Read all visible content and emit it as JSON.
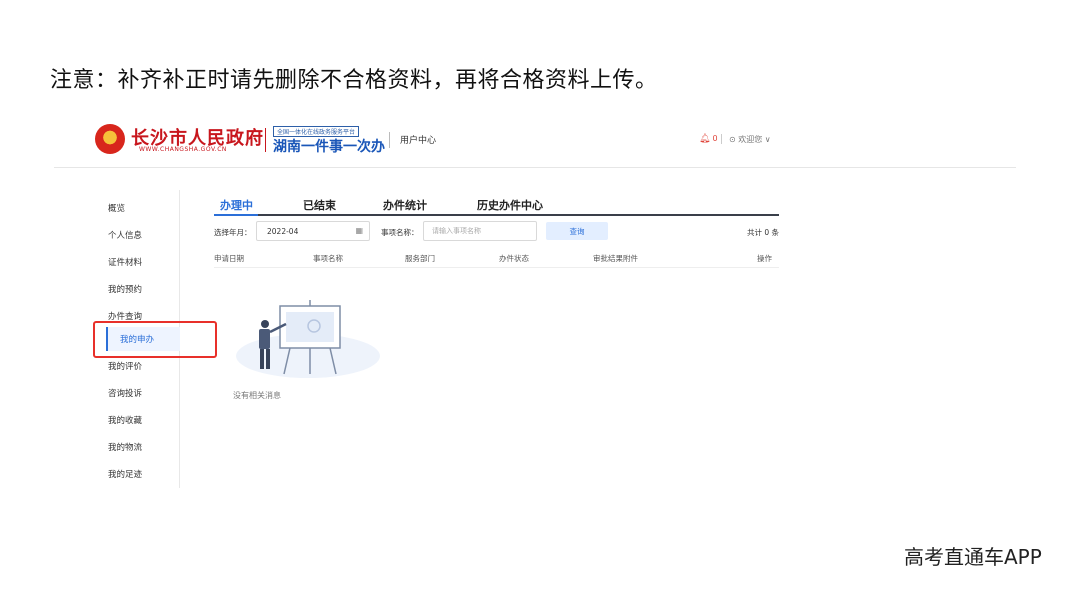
{
  "note": "注意：补齐补正时请先删除不合格资料，再将合格资料上传。",
  "header": {
    "gov_name": "长沙市人民政府",
    "gov_url": "WWW.CHANGSHA.GOV.CN",
    "platform_sub": "全国一体化在线政务服务平台",
    "platform_main": "湖南一件事一次办",
    "user_center": "用户中心",
    "bell_count": "0",
    "welcome": "欢迎您 ∨"
  },
  "sidebar": {
    "items": [
      "概览",
      "个人信息",
      "证件材料",
      "我的预约",
      "办件查询",
      "我的评价",
      "咨询投诉",
      "我的收藏",
      "我的物流",
      "我的足迹"
    ],
    "active": "我的申办"
  },
  "tabs": [
    "办理中",
    "已结束",
    "办件统计",
    "历史办件中心"
  ],
  "filter": {
    "month_label": "选择年月：",
    "month_value": "2022-04",
    "name_label": "事项名称：",
    "name_placeholder": "请输入事项名称",
    "search_label": "查询",
    "total": "共计 0 条"
  },
  "table_headers": [
    "申请日期",
    "事项名称",
    "服务部门",
    "办件状态",
    "审批结果附件",
    "操作"
  ],
  "empty_text": "没有相关消息",
  "watermark": "高考直通车APP",
  "colors": {
    "accent": "#2b6fd8",
    "gov_red": "#c8161d",
    "highlight": "#e8302a"
  }
}
